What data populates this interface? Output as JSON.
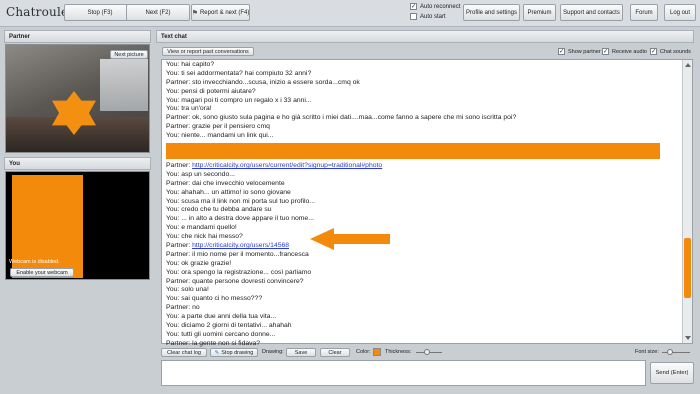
{
  "topbar": {
    "logo": "Chatroulette",
    "stop_label": "Stop (F3)",
    "next_label": "Next (F2)",
    "report_next_label": "Report & next (F4)",
    "auto_reconnect_label": "Auto reconnect",
    "auto_reconnect_checked": "✓",
    "auto_start_label": "Auto start",
    "profile_label": "Profile and settings",
    "premium_label": "Premium",
    "support_label": "Support and contacts",
    "forum_label": "Forum",
    "logout_label": "Log out"
  },
  "partner": {
    "title": "Partner",
    "next_picture_label": "Next picture"
  },
  "you": {
    "title": "You",
    "webcam_status": "Webcam is disabled.",
    "enable_webcam_label": "Enable your webcam"
  },
  "text_chat": {
    "title": "Text chat",
    "view_report_label": "View or report past conversations",
    "show_partner_label": "Show partner",
    "receive_audio_label": "Receive audio",
    "chat_sounds_label": "Chat sounds",
    "checked_mark": "✓"
  },
  "messages_top": [
    "You: hai capito?",
    "You: ti sei addormentata? hai compiuto 32 anni?",
    "Partner: sto invecchiando...scusa, inizio a essere sorda...cmq ok",
    "You: pensi di potermi aiutare?",
    "You: magari poi ti compro un regalo x i 33 anni...",
    "You: tra un'ora!",
    "Partner: ok, sono giusto sula pagina e ho già scritto i miei dati....maa...come fanno a sapere che mi sono iscritta poi?",
    "Partner: grazie per il pensiero cmq",
    "You: niente... mandami un link qui..."
  ],
  "link_message_1": {
    "prefix": "Partner: ",
    "url": "http://criticalcity.org/users/current/edit?signup=traditional#photo"
  },
  "messages_middle": [
    "You: asp un secondo...",
    "Partner: dai che invecchio velocemente",
    "You: ahahah... un attimo! io sono giovane",
    "You: scusa ma il link non mi porta sul tuo profilo...",
    "You: credo che tu debba andare su",
    "You: ... in alto a destra dove appare il tuo nome...",
    "You: e mandami quello!",
    "You: che nick hai messo?"
  ],
  "link_message_2": {
    "prefix": "Partner: ",
    "url": "http://criticalcity.org/users/14568"
  },
  "messages_bottom": [
    "Partner: il mio nome per il momento...francesca",
    "You: ok grazie grazie!",
    "You: ora spengo la registrazione... così parliamo",
    "Partner: quante persone dovresti convincere?",
    "You: solo una!",
    "You: sai quanto ci ho messo???",
    "Partner: no",
    "You: a parte due anni della tua vita...",
    "You: diciamo 2 giorni di tentativi... ahahah",
    "You: tutti gli uomini cercano donne...",
    "Partner: la gente non si fidava?"
  ],
  "toolbar": {
    "clear_chat_log_label": "Clear chat log",
    "stop_drawing_label": "Stop drawing",
    "drawing_label": "Drawing:",
    "save_label": "Save",
    "clear_label": "Clear",
    "color_label": "Color:",
    "thickness_label": "Thickness:",
    "font_size_label": "Font size:"
  },
  "send_label": "Send (Enter)",
  "colors": {
    "accent": "#f48a0c",
    "link": "#2a3bd6"
  }
}
